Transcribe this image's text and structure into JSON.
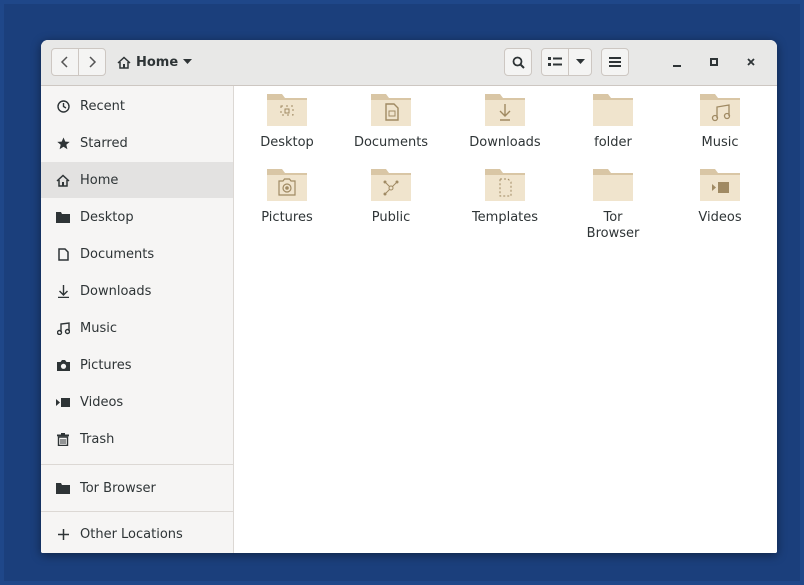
{
  "headerbar": {
    "path_label": "Home",
    "home_icon": "home-icon",
    "dropdown_icon": "triangle-down-icon"
  },
  "sidebar": {
    "items": [
      {
        "label": "Recent",
        "icon": "clock-icon"
      },
      {
        "label": "Starred",
        "icon": "star-icon"
      },
      {
        "label": "Home",
        "icon": "home-icon",
        "active": true
      },
      {
        "label": "Desktop",
        "icon": "folder-icon"
      },
      {
        "label": "Documents",
        "icon": "document-icon"
      },
      {
        "label": "Downloads",
        "icon": "download-icon"
      },
      {
        "label": "Music",
        "icon": "music-icon"
      },
      {
        "label": "Pictures",
        "icon": "camera-icon"
      },
      {
        "label": "Videos",
        "icon": "video-icon"
      },
      {
        "label": "Trash",
        "icon": "trash-icon"
      }
    ],
    "bookmarks": [
      {
        "label": "Tor Browser",
        "icon": "folder-icon"
      }
    ],
    "other_locations": {
      "label": "Other Locations",
      "icon": "plus-icon"
    }
  },
  "files": [
    {
      "name": "Desktop",
      "emblem": "desktop"
    },
    {
      "name": "Documents",
      "emblem": "document"
    },
    {
      "name": "Downloads",
      "emblem": "download"
    },
    {
      "name": "folder",
      "emblem": "none"
    },
    {
      "name": "Music",
      "emblem": "music"
    },
    {
      "name": "Pictures",
      "emblem": "camera"
    },
    {
      "name": "Public",
      "emblem": "share"
    },
    {
      "name": "Templates",
      "emblem": "template"
    },
    {
      "name": "Tor Browser",
      "emblem": "none"
    },
    {
      "name": "Videos",
      "emblem": "video"
    }
  ],
  "colors": {
    "desktop_bg": "#1f4789",
    "folder_body": "#f0e4cd",
    "folder_tab": "#d9c6a5",
    "emblem": "#a08a63"
  }
}
